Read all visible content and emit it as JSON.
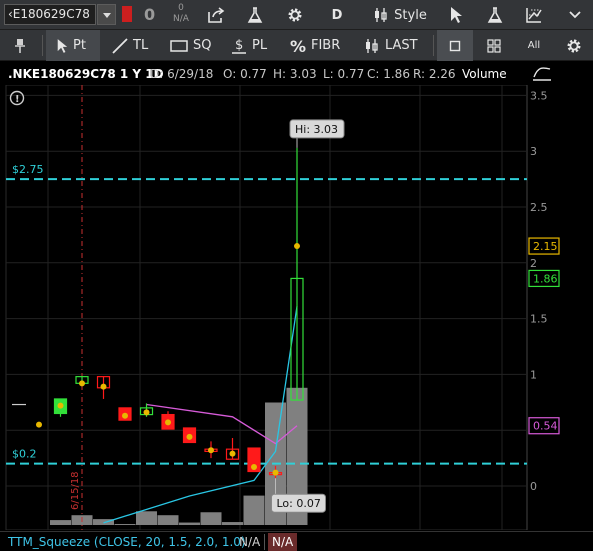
{
  "toolbar": {
    "symbol": "‹E180629C78",
    "position_qty": "0",
    "position_na": "N/A",
    "position_na_zero": "0",
    "aggregation": "D",
    "style_label": "Style"
  },
  "drawing_toolbar": {
    "pin_label": "",
    "pointer_label": "Pt",
    "trendline_label": "TL",
    "square_label": "SQ",
    "pricelevel_label": "PL",
    "fibonacci_label": "FIBR",
    "last_label": "LAST",
    "all_label": "All"
  },
  "chart_header": {
    "symbol": ".NKE180629C78 1 Y 1D",
    "date": "D: 6/29/18",
    "open": "O: 0.77",
    "high": "H: 3.03",
    "low": "L: 0.77",
    "close": "C: 1.86",
    "range": "R: 2.26",
    "volume": "Volume"
  },
  "study_bar": {
    "name": "TTM_Squeeze (CLOSE, 20, 1.5, 2.0, 1.0)",
    "value1": "N/A",
    "value2": "N/A"
  },
  "colors": {
    "up": "#33e03a",
    "down": "#ff1a1a",
    "dot": "#e8b800",
    "level_line": "#2fd0d8",
    "ma_cyan": "#29c6e4",
    "ma_magenta": "#d65bd8",
    "volume": "#808080",
    "grid": "#222222",
    "event_line": "#c83030"
  },
  "chart_data": {
    "type": "candlestick",
    "title": ".NKE180629C78 1 Y 1D",
    "y_range": [
      -0.35,
      3.55
    ],
    "y_ticks": [
      0,
      0.5,
      1,
      1.5,
      2,
      2.5,
      3,
      3.5
    ],
    "price_badges": [
      {
        "label": "2.15",
        "value": 2.15,
        "color": "#e8b800"
      },
      {
        "label": "1.86",
        "value": 1.86,
        "color": "#33e03a"
      },
      {
        "label": "0.54",
        "value": 0.54,
        "color": "#d65bd8"
      }
    ],
    "horizontal_levels": [
      {
        "label": "$2.75",
        "value": 2.75
      },
      {
        "label": "$0.2",
        "value": 0.2
      }
    ],
    "annotations": [
      {
        "label": "Hi: 3.03",
        "value": 3.03,
        "bar": 12
      },
      {
        "label": "Lo: 0.07",
        "value": 0.07,
        "bar": 11
      }
    ],
    "event_marker": {
      "label": "6/15/18",
      "bar": 2
    },
    "dash_marker": {
      "value": 0.73
    },
    "candles": [
      {
        "o": 0.55,
        "h": 0.55,
        "l": 0.55,
        "c": 0.55,
        "dir": "flat"
      },
      {
        "o": 0.65,
        "h": 0.78,
        "l": 0.62,
        "c": 0.78,
        "dir": "up"
      },
      {
        "o": 0.98,
        "h": 0.98,
        "l": 0.92,
        "c": 0.92,
        "dir": "flat_up"
      },
      {
        "o": 0.98,
        "h": 0.98,
        "l": 0.78,
        "c": 0.88,
        "dir": "flat_down"
      },
      {
        "o": 0.7,
        "h": 0.7,
        "l": 0.59,
        "c": 0.59,
        "dir": "down"
      },
      {
        "o": 0.64,
        "h": 0.74,
        "l": 0.62,
        "c": 0.7,
        "dir": "flat_up"
      },
      {
        "o": 0.64,
        "h": 0.67,
        "l": 0.51,
        "c": 0.51,
        "dir": "down"
      },
      {
        "o": 0.52,
        "h": 0.52,
        "l": 0.39,
        "c": 0.39,
        "dir": "down"
      },
      {
        "o": 0.33,
        "h": 0.4,
        "l": 0.25,
        "c": 0.31,
        "dir": "flat_down"
      },
      {
        "o": 0.33,
        "h": 0.43,
        "l": 0.24,
        "c": 0.24,
        "dir": "flat_down"
      },
      {
        "o": 0.34,
        "h": 0.34,
        "l": 0.13,
        "c": 0.13,
        "dir": "down"
      },
      {
        "o": 0.12,
        "h": 0.18,
        "l": 0.07,
        "c": 0.12,
        "dir": "flat_down"
      },
      {
        "o": 0.77,
        "h": 3.03,
        "l": 0.77,
        "c": 1.86,
        "dir": "up"
      }
    ],
    "close_dots": [
      0.55,
      0.72,
      0.92,
      0.89,
      0.63,
      0.66,
      0.57,
      0.44,
      0.32,
      0.29,
      0.17,
      0.12,
      2.15
    ],
    "volume": [
      0,
      1,
      2,
      1.2,
      0.2,
      2.8,
      2,
      0.5,
      2.6,
      0.6,
      6,
      25,
      28
    ],
    "ma_magenta": [
      {
        "bar": 5,
        "value": 0.73
      },
      {
        "bar": 9,
        "value": 0.62
      },
      {
        "bar": 11,
        "value": 0.38
      },
      {
        "bar": 12,
        "value": 0.54
      }
    ],
    "ma_cyan": [
      {
        "bar": 3,
        "value": -0.33
      },
      {
        "bar": 7,
        "value": -0.09
      },
      {
        "bar": 10,
        "value": 0.05
      },
      {
        "bar": 11,
        "value": 0.31
      },
      {
        "bar": 12,
        "value": 1.61
      }
    ]
  }
}
